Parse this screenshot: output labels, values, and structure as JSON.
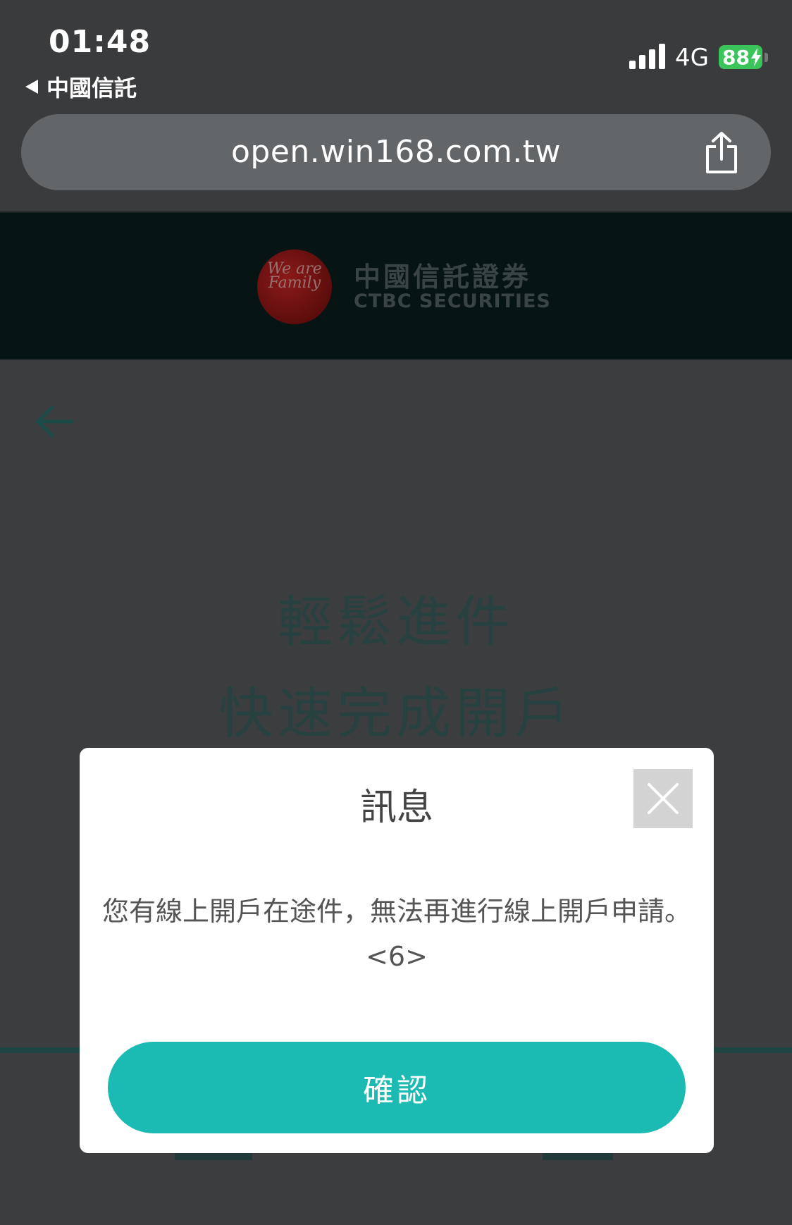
{
  "status_bar": {
    "time": "01:48",
    "back_app": "中國信託",
    "network": "4G",
    "battery": "88"
  },
  "browser": {
    "url": "open.win168.com.tw"
  },
  "header": {
    "logo_text": "We are Family",
    "brand_zh": "中國信託證券",
    "brand_en": "CTBC SECURITIES"
  },
  "hero": {
    "line1": "輕鬆進件",
    "line2": "快速完成開戶"
  },
  "dialog": {
    "title": "訊息",
    "message": "您有線上開戶在途件，無法再進行線上開戶申請。<6>",
    "confirm_label": "確認"
  },
  "colors": {
    "accent": "#1bbab3",
    "battery": "#3bc45a",
    "header_bg": "#061413"
  }
}
